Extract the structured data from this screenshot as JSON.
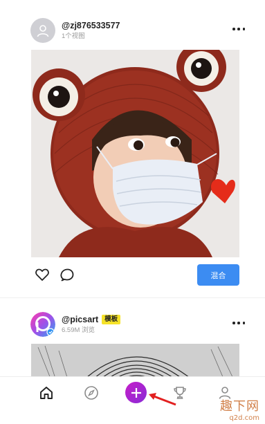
{
  "feed": {
    "posts": [
      {
        "username": "@zj876533577",
        "meta": "1个视图",
        "remix_label": "混合"
      },
      {
        "username": "@picsart",
        "badge": "模板",
        "meta": "6.59M 浏览"
      }
    ]
  },
  "tabbar": {
    "items": [
      "home-icon",
      "compass-icon",
      "plus-icon",
      "trophy-icon",
      "profile-icon"
    ],
    "accent_color": "#b51fcf"
  },
  "watermark": {
    "title": "趣下网",
    "url": "q2d.com"
  },
  "colors": {
    "remix_button": "#3c8cf2",
    "badge": "#f5e229",
    "arrow": "#e22020"
  }
}
